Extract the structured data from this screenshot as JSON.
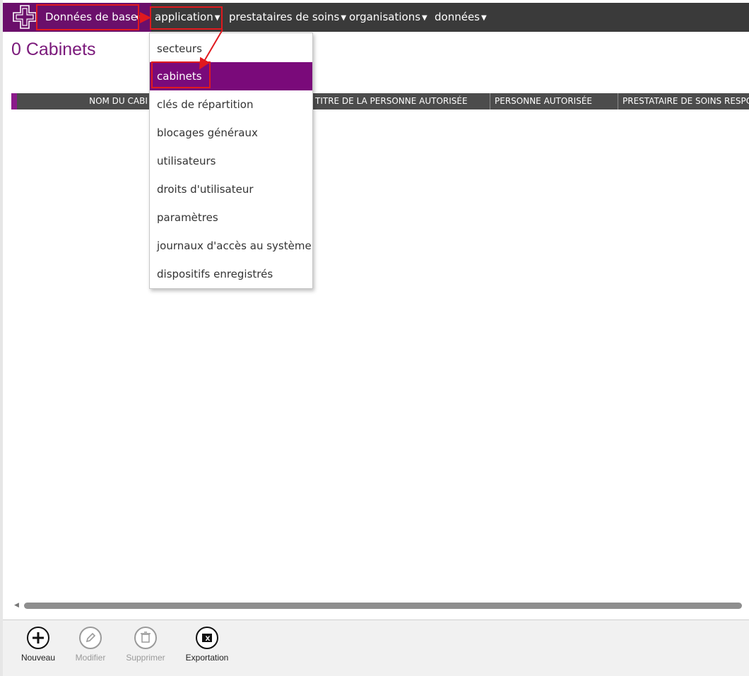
{
  "nav": {
    "base": {
      "label": "Données de base"
    },
    "items": [
      {
        "label": "application"
      },
      {
        "label": "prestataires de soins"
      },
      {
        "label": "organisations"
      },
      {
        "label": "données"
      }
    ]
  },
  "page": {
    "title": "0 Cabinets"
  },
  "table": {
    "columns": [
      "NOM DU CABI",
      "TITRE DE LA PERSONNE AUTORISÉE",
      "PERSONNE AUTORISÉE",
      "PRESTATAIRE DE SOINS RESPON"
    ]
  },
  "dropdown": {
    "items": [
      {
        "label": "secteurs"
      },
      {
        "label": "cabinets",
        "active": true
      },
      {
        "label": "clés de répartition"
      },
      {
        "label": "blocages généraux"
      },
      {
        "label": "utilisateurs"
      },
      {
        "label": "droits d'utilisateur"
      },
      {
        "label": "paramètres"
      },
      {
        "label": "journaux d'accès au système"
      },
      {
        "label": "dispositifs enregistrés"
      }
    ]
  },
  "toolbar": {
    "new_label": "Nouveau",
    "edit_label": "Modifier",
    "delete_label": "Supprimer",
    "export_label": "Exportation"
  },
  "colors": {
    "brand_purple": "#6b0f6b",
    "menu_active": "#7a0a7a",
    "title_purple": "#7b1a7b",
    "annotation_red": "#e0191e",
    "nav_dark": "#3a3a3a"
  }
}
